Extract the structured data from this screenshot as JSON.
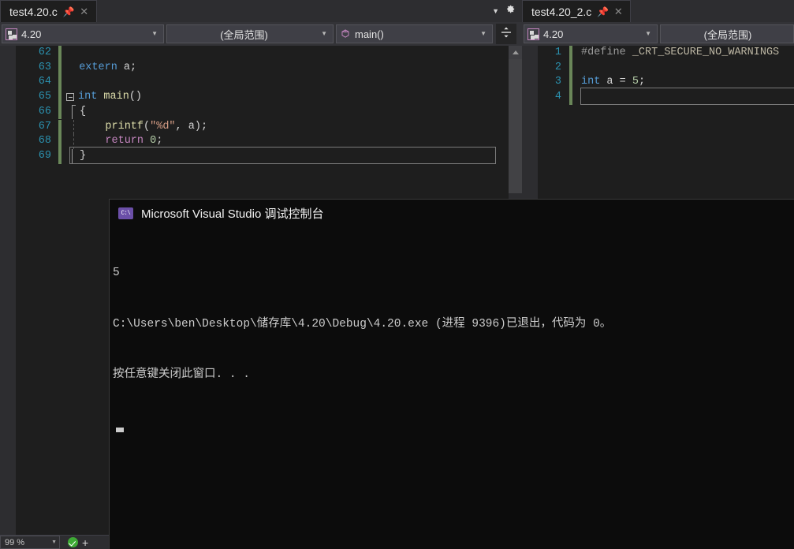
{
  "app": {
    "name": "Microsoft Visual Studio",
    "theme_bg": "#1e1e1e",
    "accent": "#007acc"
  },
  "left_pane": {
    "tab": {
      "label": "test4.20.c",
      "pin_icon": "pin-icon",
      "close_icon": "close-icon"
    },
    "tabstrip_actions": {
      "chevron_icon": "chevron-down-icon",
      "settings_icon": "gear-icon"
    },
    "navbar": {
      "project_combo": "4.20",
      "scope_combo": "(全局范围)",
      "member_combo": "main()",
      "split_button": "split-window-icon"
    },
    "editor": {
      "first_line_number": 62,
      "lines": [
        {
          "num": 62,
          "text": ""
        },
        {
          "num": 63,
          "text": "  extern a;"
        },
        {
          "num": 64,
          "text": ""
        },
        {
          "num": 65,
          "text": "int main()"
        },
        {
          "num": 66,
          "text": "  {"
        },
        {
          "num": 67,
          "text": "      printf(\"%d\", a);"
        },
        {
          "num": 68,
          "text": "      return 0;"
        },
        {
          "num": 69,
          "text": "  }"
        }
      ]
    },
    "status": {
      "zoom": "99 %",
      "zoom_arrow_icon": "chevron-down-icon",
      "ok_icon": "check-circle-icon",
      "add_icon": "plus-icon"
    }
  },
  "right_pane": {
    "tab": {
      "label": "test4.20_2.c",
      "pin_icon": "pin-icon",
      "close_icon": "close-icon"
    },
    "navbar": {
      "project_combo": "4.20",
      "scope_combo": "(全局范围)"
    },
    "editor": {
      "lines": [
        {
          "num": 1,
          "text": "#define _CRT_SECURE_NO_WARNINGS"
        },
        {
          "num": 2,
          "text": ""
        },
        {
          "num": 3,
          "text": "int a = 5;"
        },
        {
          "num": 4,
          "text": ""
        }
      ]
    }
  },
  "console": {
    "icon": "console-icon",
    "icon_text": "C:\\",
    "title": "Microsoft Visual Studio 调试控制台",
    "lines": [
      "5",
      "C:\\Users\\ben\\Desktop\\储存库\\4.20\\Debug\\4.20.exe (进程 9396)已退出，代码为 0。",
      "按任意键关闭此窗口. . ."
    ]
  }
}
